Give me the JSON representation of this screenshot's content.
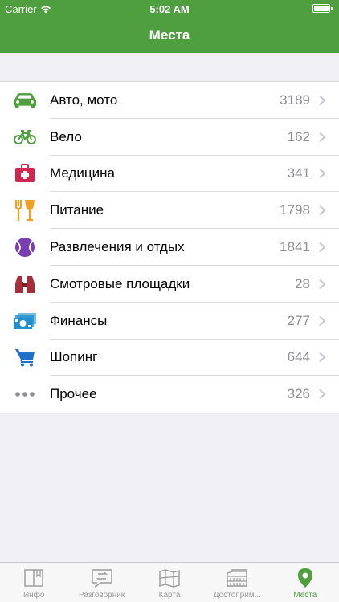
{
  "status": {
    "carrier": "Carrier",
    "time": "5:02 AM"
  },
  "nav": {
    "title": "Места"
  },
  "categories": [
    {
      "label": "Авто, мото",
      "count": "3189",
      "icon": "car-icon"
    },
    {
      "label": "Вело",
      "count": "162",
      "icon": "bicycle-icon"
    },
    {
      "label": "Медицина",
      "count": "341",
      "icon": "medical-kit-icon"
    },
    {
      "label": "Питание",
      "count": "1798",
      "icon": "fork-glass-icon"
    },
    {
      "label": "Развлечения и отдых",
      "count": "1841",
      "icon": "tennis-ball-icon"
    },
    {
      "label": "Смотровые площадки",
      "count": "28",
      "icon": "binoculars-icon"
    },
    {
      "label": "Финансы",
      "count": "277",
      "icon": "money-icon"
    },
    {
      "label": "Шопинг",
      "count": "644",
      "icon": "shopping-cart-icon"
    },
    {
      "label": "Прочее",
      "count": "326",
      "icon": "more-dots-icon"
    }
  ],
  "tabs": [
    {
      "label": "Инфо",
      "icon": "book-icon",
      "active": false
    },
    {
      "label": "Разговорник",
      "icon": "phrasebook-icon",
      "active": false
    },
    {
      "label": "Карта",
      "icon": "map-icon",
      "active": false
    },
    {
      "label": "Достоприм...",
      "icon": "colosseum-icon",
      "active": false
    },
    {
      "label": "Места",
      "icon": "location-pin-icon",
      "active": true
    }
  ],
  "colors": {
    "brand": "#4f9e3f",
    "count": "#8e8e93",
    "inactive_tab": "#9a9a9a"
  }
}
